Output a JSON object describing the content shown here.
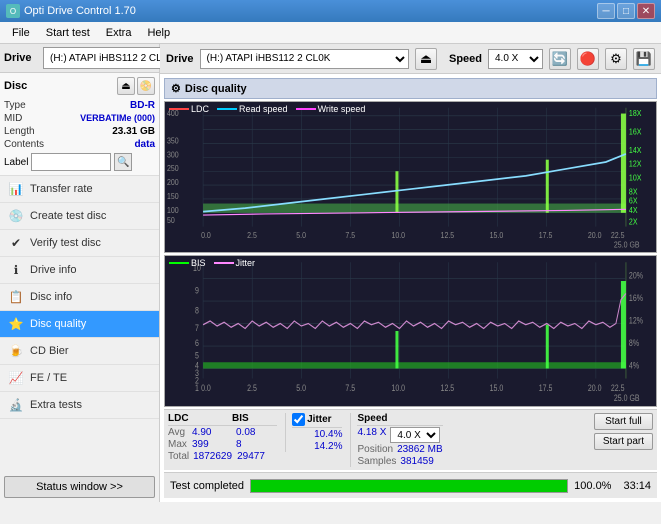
{
  "titleBar": {
    "title": "Opti Drive Control 1.70",
    "minBtn": "─",
    "maxBtn": "□",
    "closeBtn": "✕"
  },
  "menuBar": {
    "items": [
      "File",
      "Start test",
      "Extra",
      "Help"
    ]
  },
  "driveToolbar": {
    "driveLabel": "Drive",
    "driveValue": "(H:) ATAPI iHBS112  2 CL0K",
    "speedLabel": "Speed",
    "speedValue": "4.0 X"
  },
  "discPanel": {
    "title": "Disc",
    "typeLabel": "Type",
    "typeValue": "BD-R",
    "midLabel": "MID",
    "midValue": "VERBATIMe (000)",
    "lengthLabel": "Length",
    "lengthValue": "23.31 GB",
    "contentsLabel": "Contents",
    "contentsValue": "data",
    "labelLabel": "Label",
    "labelValue": ""
  },
  "sidebarItems": [
    {
      "id": "transfer-rate",
      "label": "Transfer rate",
      "icon": "📊",
      "active": false
    },
    {
      "id": "create-test-disc",
      "label": "Create test disc",
      "icon": "💿",
      "active": false
    },
    {
      "id": "verify-test-disc",
      "label": "Verify test disc",
      "icon": "✔",
      "active": false
    },
    {
      "id": "drive-info",
      "label": "Drive info",
      "icon": "ℹ",
      "active": false
    },
    {
      "id": "disc-info",
      "label": "Disc info",
      "icon": "📋",
      "active": false
    },
    {
      "id": "disc-quality",
      "label": "Disc quality",
      "icon": "⭐",
      "active": true
    },
    {
      "id": "cd-bier",
      "label": "CD Bier",
      "icon": "🍺",
      "active": false
    },
    {
      "id": "fe-te",
      "label": "FE / TE",
      "icon": "📈",
      "active": false
    },
    {
      "id": "extra-tests",
      "label": "Extra tests",
      "icon": "🔬",
      "active": false
    }
  ],
  "statusButton": "Status window >>",
  "qualityPanel": {
    "title": "Disc quality",
    "panelIcon": "⚙"
  },
  "chart1": {
    "legend": [
      {
        "label": "LDC",
        "color": "#ff4444"
      },
      {
        "label": "Read speed",
        "color": "#00ccff"
      },
      {
        "label": "Write speed",
        "color": "#ff44ff"
      }
    ],
    "yAxisMax": 400,
    "yLabelsRight": [
      "18X",
      "16X",
      "14X",
      "12X",
      "10X",
      "8X",
      "6X",
      "4X",
      "2X"
    ],
    "xAxisMax": 25.0
  },
  "chart2": {
    "legend": [
      {
        "label": "BIS",
        "color": "#00ff00"
      },
      {
        "label": "Jitter",
        "color": "#ff88ff"
      }
    ],
    "yAxisMax": 10,
    "yLabelsRight": [
      "20%",
      "16%",
      "12%",
      "8%",
      "4%"
    ],
    "xAxisMax": 25.0
  },
  "statsSection": {
    "headers": [
      "LDC",
      "BIS",
      "",
      "Jitter",
      "Speed",
      ""
    ],
    "avgLabel": "Avg",
    "avgLDC": "4.90",
    "avgBIS": "0.08",
    "avgJitter": "10.4%",
    "avgSpeed": "4.18 X",
    "speedSelect": "4.0 X",
    "maxLabel": "Max",
    "maxLDC": "399",
    "maxBIS": "8",
    "maxJitter": "14.2%",
    "positionLabel": "Position",
    "positionValue": "23862 MB",
    "totalLabel": "Total",
    "totalLDC": "1872629",
    "totalBIS": "29477",
    "samplesLabel": "Samples",
    "samplesValue": "381459",
    "jitterChecked": true
  },
  "bottomBar": {
    "statusText": "Test completed",
    "progressValue": 100,
    "progressText": "100.0%",
    "timeText": "33:14"
  },
  "actionButtons": {
    "startFull": "Start full",
    "startPart": "Start part"
  }
}
